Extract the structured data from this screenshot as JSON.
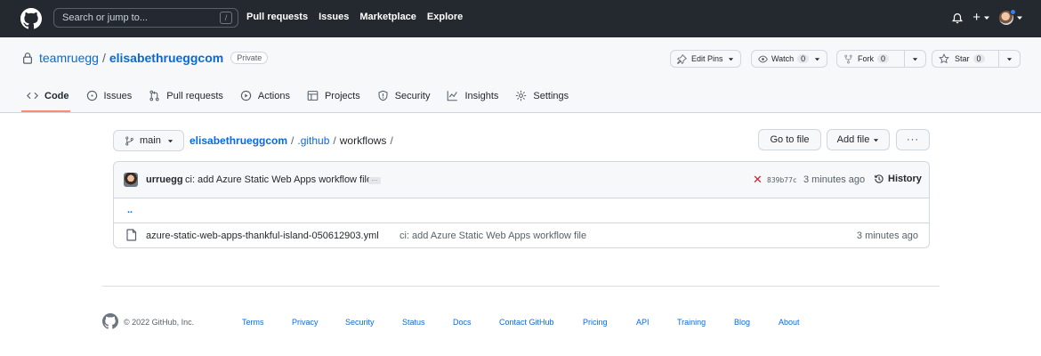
{
  "header": {
    "search_placeholder": "Search or jump to...",
    "search_shortcut": "/",
    "nav": [
      "Pull requests",
      "Issues",
      "Marketplace",
      "Explore"
    ],
    "plus_label": "+"
  },
  "repo": {
    "owner": "teamruegg",
    "separator": "/",
    "name": "elisabethrueggcom",
    "visibility": "Private",
    "edit_pins_label": "Edit Pins",
    "watch_label": "Watch",
    "watch_count": "0",
    "fork_label": "Fork",
    "fork_count": "0",
    "star_label": "Star",
    "star_count": "0"
  },
  "tabs": [
    {
      "label": "Code",
      "icon": "code-icon",
      "active": true
    },
    {
      "label": "Issues",
      "icon": "issue-icon"
    },
    {
      "label": "Pull requests",
      "icon": "pull-request-icon"
    },
    {
      "label": "Actions",
      "icon": "play-icon"
    },
    {
      "label": "Projects",
      "icon": "table-icon"
    },
    {
      "label": "Security",
      "icon": "shield-icon"
    },
    {
      "label": "Insights",
      "icon": "graph-icon"
    },
    {
      "label": "Settings",
      "icon": "gear-icon"
    }
  ],
  "toolbar": {
    "branch": "main",
    "breadcrumb": [
      "elisabethrueggcom",
      ".github",
      "workflows"
    ],
    "breadcrumb_sep": "/",
    "go_to_file": "Go to file",
    "add_file": "Add file",
    "more": "···"
  },
  "commit": {
    "author": "urruegg",
    "message": "ci: add Azure Static Web Apps workflow file",
    "ellipsis": "…",
    "status": "✕",
    "status_color": "#cf222e",
    "sha": "839b77c",
    "time": "3 minutes ago",
    "history_label": "History"
  },
  "files": {
    "parent": "..",
    "rows": [
      {
        "name": "azure-static-web-apps-thankful-island-050612903.yml",
        "message": "ci: add Azure Static Web Apps workflow file",
        "time": "3 minutes ago"
      }
    ]
  },
  "footer": {
    "copyright": "© 2022 GitHub, Inc.",
    "links": [
      "Terms",
      "Privacy",
      "Security",
      "Status",
      "Docs",
      "Contact GitHub",
      "Pricing",
      "API",
      "Training",
      "Blog",
      "About"
    ]
  },
  "colors": {
    "header_bg": "#24292f",
    "link": "#0969da",
    "tab_underline": "#fd8c73"
  }
}
